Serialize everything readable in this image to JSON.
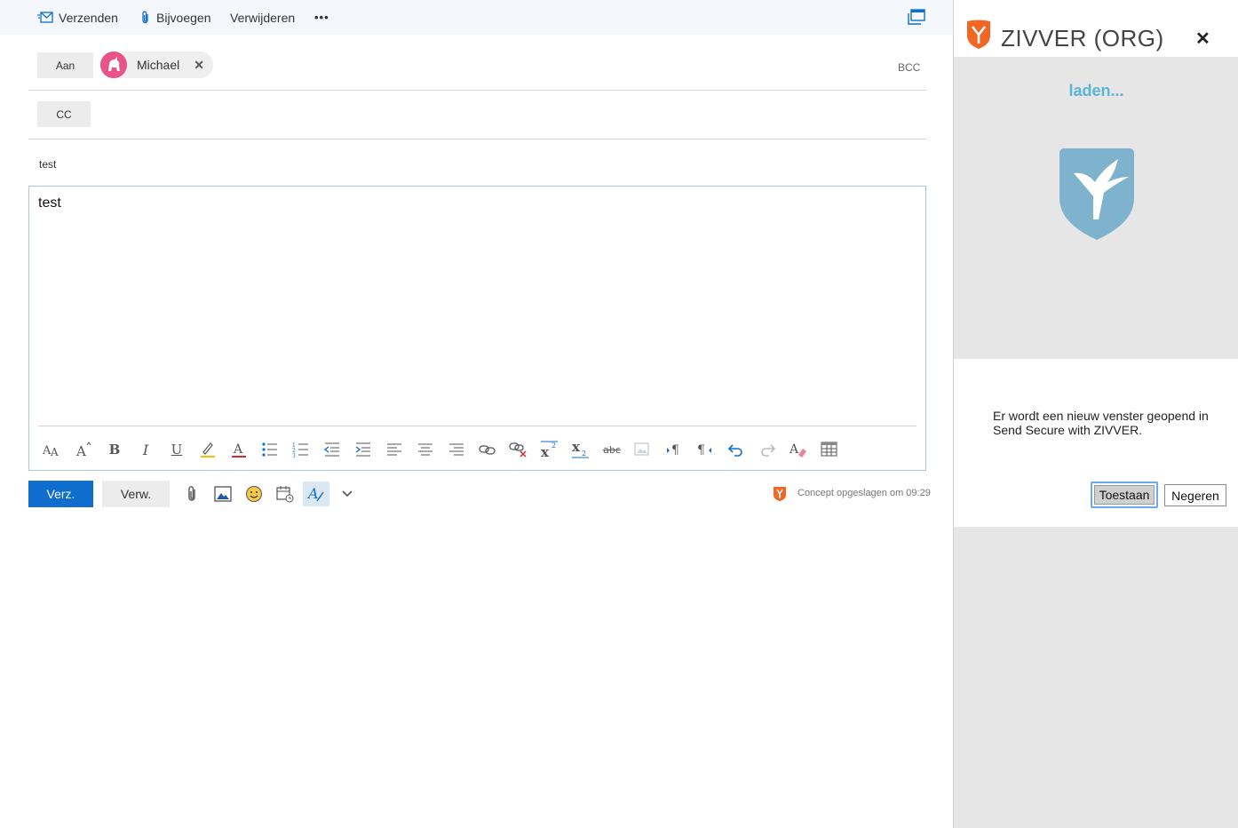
{
  "toolbar": {
    "send_label": "Verzenden",
    "attach_label": "Bijvoegen",
    "delete_label": "Verwijderen",
    "more_label": "•••"
  },
  "recipients": {
    "to_label": "Aan",
    "to_chip_name": "Michael",
    "cc_label": "CC",
    "bcc_label": "BCC"
  },
  "subject": "test",
  "body_text": "test",
  "bottom": {
    "send_label": "Verz.",
    "discard_label": "Verw.",
    "saved_status": "Concept opgeslagen om 09:29"
  },
  "format_toolbar": {
    "icons": [
      "font-size-icon",
      "grow-font-icon",
      "bold-icon",
      "italic-icon",
      "underline-icon",
      "highlight-icon",
      "font-color-icon",
      "bullets-icon",
      "numbering-icon",
      "decrease-indent-icon",
      "increase-indent-icon",
      "align-left-icon",
      "align-center-icon",
      "align-right-icon",
      "insert-link-icon",
      "remove-link-icon",
      "superscript-icon",
      "subscript-icon",
      "strikethrough-icon",
      "insert-picture-icon",
      "ltr-icon",
      "rtl-icon",
      "undo-icon",
      "redo-icon",
      "clear-formatting-icon",
      "insert-table-icon"
    ]
  },
  "addin": {
    "title": "ZIVVER (ORG)",
    "loading_text": "laden...",
    "dialog_message": "Er wordt een nieuw venster geopend in Send Secure with ZIVVER.",
    "allow_label": "Toestaan",
    "ignore_label": "Negeren"
  },
  "colors": {
    "accent_blue": "#0f6ecd",
    "zivver_orange": "#f26522",
    "shield_blue": "#7fb2cc",
    "loading_blue": "#5ab4d6"
  }
}
